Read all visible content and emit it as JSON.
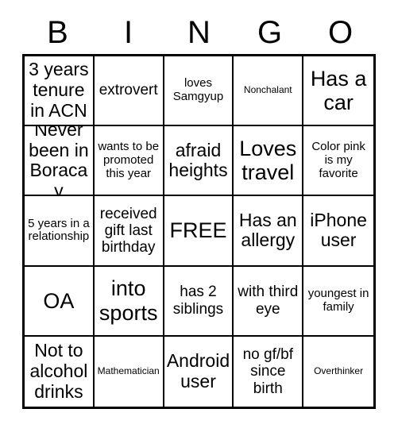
{
  "card": {
    "header_letters": [
      "B",
      "I",
      "N",
      "G",
      "O"
    ],
    "rows": [
      [
        {
          "text": "3 years tenure in ACN",
          "size": "t-lg"
        },
        {
          "text": "extrovert",
          "size": "t-md"
        },
        {
          "text": "loves Samgyup",
          "size": "t-sm"
        },
        {
          "text": "Nonchalant",
          "size": "t-xs"
        },
        {
          "text": "Has a car",
          "size": "t-xl"
        }
      ],
      [
        {
          "text": "Never been in Boracay",
          "size": "t-lg"
        },
        {
          "text": "wants to be promoted this year",
          "size": "t-sm"
        },
        {
          "text": "afraid heights",
          "size": "t-lg"
        },
        {
          "text": "Loves travel",
          "size": "t-xl"
        },
        {
          "text": "Color pink is my favorite",
          "size": "t-sm"
        }
      ],
      [
        {
          "text": "5 years in a relationship",
          "size": "t-sm"
        },
        {
          "text": "received gift last birthday",
          "size": "t-md"
        },
        {
          "text": "FREE",
          "size": "t-xl"
        },
        {
          "text": "Has an allergy",
          "size": "t-lg"
        },
        {
          "text": "iPhone user",
          "size": "t-lg"
        }
      ],
      [
        {
          "text": "OA",
          "size": "t-xl"
        },
        {
          "text": "into sports",
          "size": "t-xl"
        },
        {
          "text": "has 2 siblings",
          "size": "t-md"
        },
        {
          "text": "with third eye",
          "size": "t-md"
        },
        {
          "text": "youngest in family",
          "size": "t-sm"
        }
      ],
      [
        {
          "text": "Not to alcohol drinks",
          "size": "t-lg"
        },
        {
          "text": "Mathematician",
          "size": "t-xs"
        },
        {
          "text": "Android user",
          "size": "t-lg"
        },
        {
          "text": "no gf/bf since birth",
          "size": "t-md"
        },
        {
          "text": "Overthinker",
          "size": "t-xs"
        }
      ]
    ]
  },
  "colors": {
    "ink": "#000000",
    "paper": "#ffffff"
  }
}
